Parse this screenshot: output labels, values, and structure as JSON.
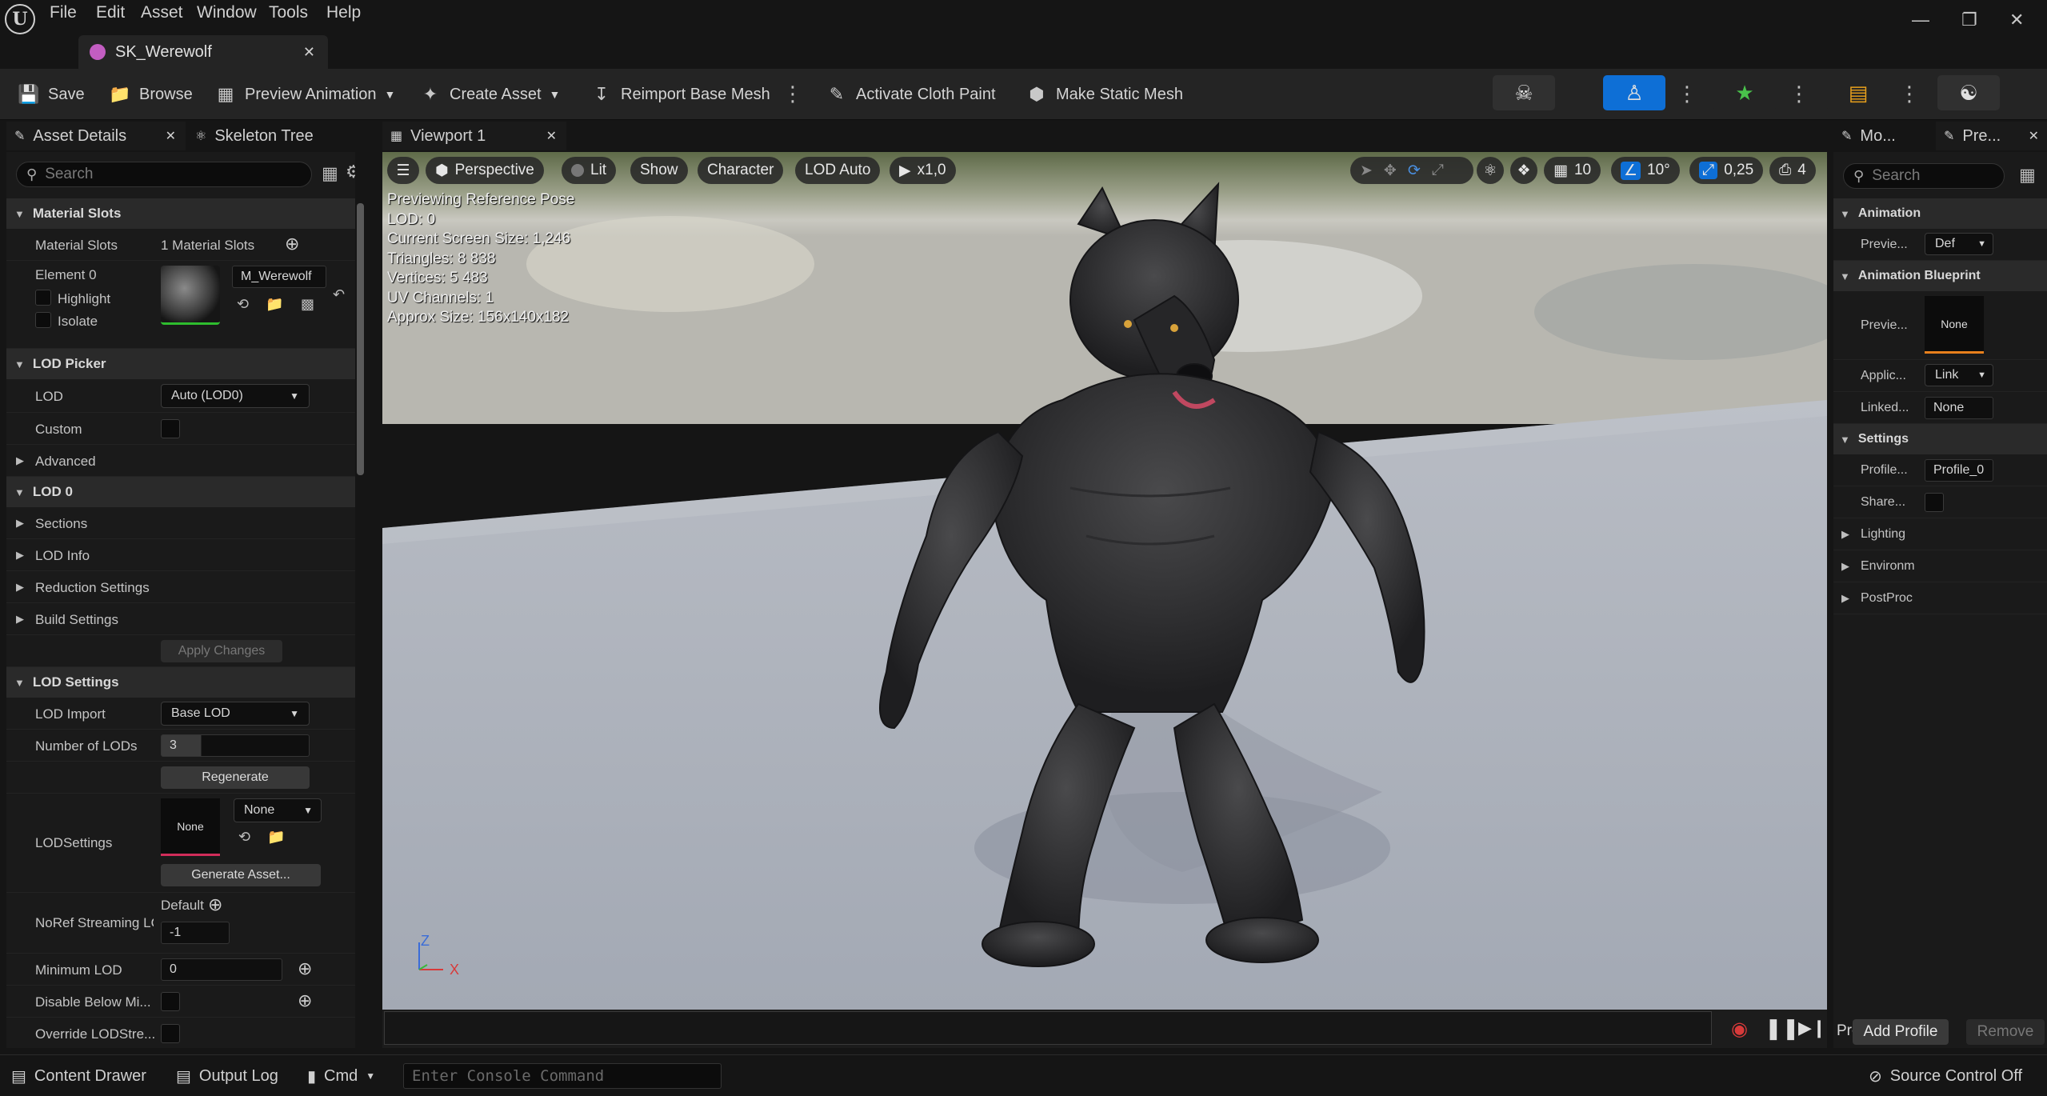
{
  "menu": {
    "items": [
      "File",
      "Edit",
      "Asset",
      "Window",
      "Tools",
      "Help"
    ]
  },
  "document_tab": {
    "title": "SK_Werewolf"
  },
  "toolbar": {
    "save": "Save",
    "browse": "Browse",
    "preview_animation": "Preview Animation",
    "create_asset": "Create Asset",
    "reimport": "Reimport Base Mesh",
    "cloth_paint": "Activate Cloth Paint",
    "static_mesh": "Make Static Mesh",
    "modes": [
      "skeleton-icon",
      "mesh-icon",
      "animation-icon",
      "blueprint-icon",
      "physics-icon"
    ]
  },
  "left_tabs": {
    "asset_details": "Asset Details",
    "skeleton_tree": "Skeleton Tree"
  },
  "details": {
    "search_placeholder": "Search",
    "material_slots_header": "Material Slots",
    "material_slots_label": "Material Slots",
    "material_slots_value": "1 Material Slots",
    "element0_label": "Element 0",
    "highlight_label": "Highlight",
    "isolate_label": "Isolate",
    "material_name": "M_Werewolf",
    "lod_picker_header": "LOD Picker",
    "lod_label": "LOD",
    "lod_value": "Auto (LOD0)",
    "custom_label": "Custom",
    "advanced_label": "Advanced",
    "lod0_header": "LOD 0",
    "sections_label": "Sections",
    "lod_info_label": "LOD Info",
    "reduction_label": "Reduction Settings",
    "build_label": "Build Settings",
    "apply_changes": "Apply Changes",
    "lod_settings_header": "LOD Settings",
    "lod_import_label": "LOD Import",
    "lod_import_value": "Base LOD",
    "num_lods_label": "Number of LODs",
    "num_lods_value": "3",
    "regenerate": "Regenerate",
    "lodsettings_label": "LODSettings",
    "lodsettings_thumb": "None",
    "lodsettings_value": "None",
    "generate_asset": "Generate Asset...",
    "noref_label": "NoRef Streaming LO",
    "noref_default": "Default",
    "noref_value": "-1",
    "min_lod_label": "Minimum LOD",
    "min_lod_value": "0",
    "disable_below_label": "Disable Below Mi...",
    "override_label": "Override LODStre..."
  },
  "viewport_tab": {
    "title": "Viewport 1"
  },
  "viewport": {
    "perspective": "Perspective",
    "lit": "Lit",
    "show": "Show",
    "character": "Character",
    "lod_auto": "LOD Auto",
    "speed": "x1,0",
    "grid_snap": "10",
    "rot_snap": "10°",
    "scale_snap": "0,25",
    "cam_speed": "4",
    "stats": [
      "Previewing Reference Pose",
      "LOD: 0",
      "Current Screen Size: 1,246",
      "Triangles: 8 838",
      "Vertices: 5 483",
      "UV Channels: 1",
      "Approx Size: 156x140x182"
    ],
    "axis_z": "Z",
    "axis_x": "X"
  },
  "right_tabs": {
    "tab1": "Mo...",
    "tab2": "Pre..."
  },
  "preview_settings": {
    "search_placeholder": "Search",
    "animation_header": "Animation",
    "preview_label": "Previe...",
    "preview_value": "Def",
    "anim_bp_header": "Animation Blueprint",
    "bp_preview_label": "Previe...",
    "bp_preview_value": "None",
    "applic_label": "Applic...",
    "applic_value": "Link",
    "linked_label": "Linked...",
    "linked_value": "None",
    "settings_header": "Settings",
    "profile_label": "Profile...",
    "profile_value": "Profile_0",
    "share_label": "Share...",
    "lighting_label": "Lighting",
    "environment_label": "Environm",
    "postprocess_label": "PostProc",
    "profile_footer": "Profile",
    "add_profile": "Add Profile",
    "remove": "Remove"
  },
  "statusbar": {
    "content_drawer": "Content Drawer",
    "output_log": "Output Log",
    "cmd": "Cmd",
    "console_placeholder": "Enter Console Command",
    "source_control": "Source Control Off"
  },
  "colors": {
    "accent_blue": "#0e6fd6",
    "background": "#151515",
    "panel": "#1a1a1a",
    "toolbar": "#242424"
  }
}
